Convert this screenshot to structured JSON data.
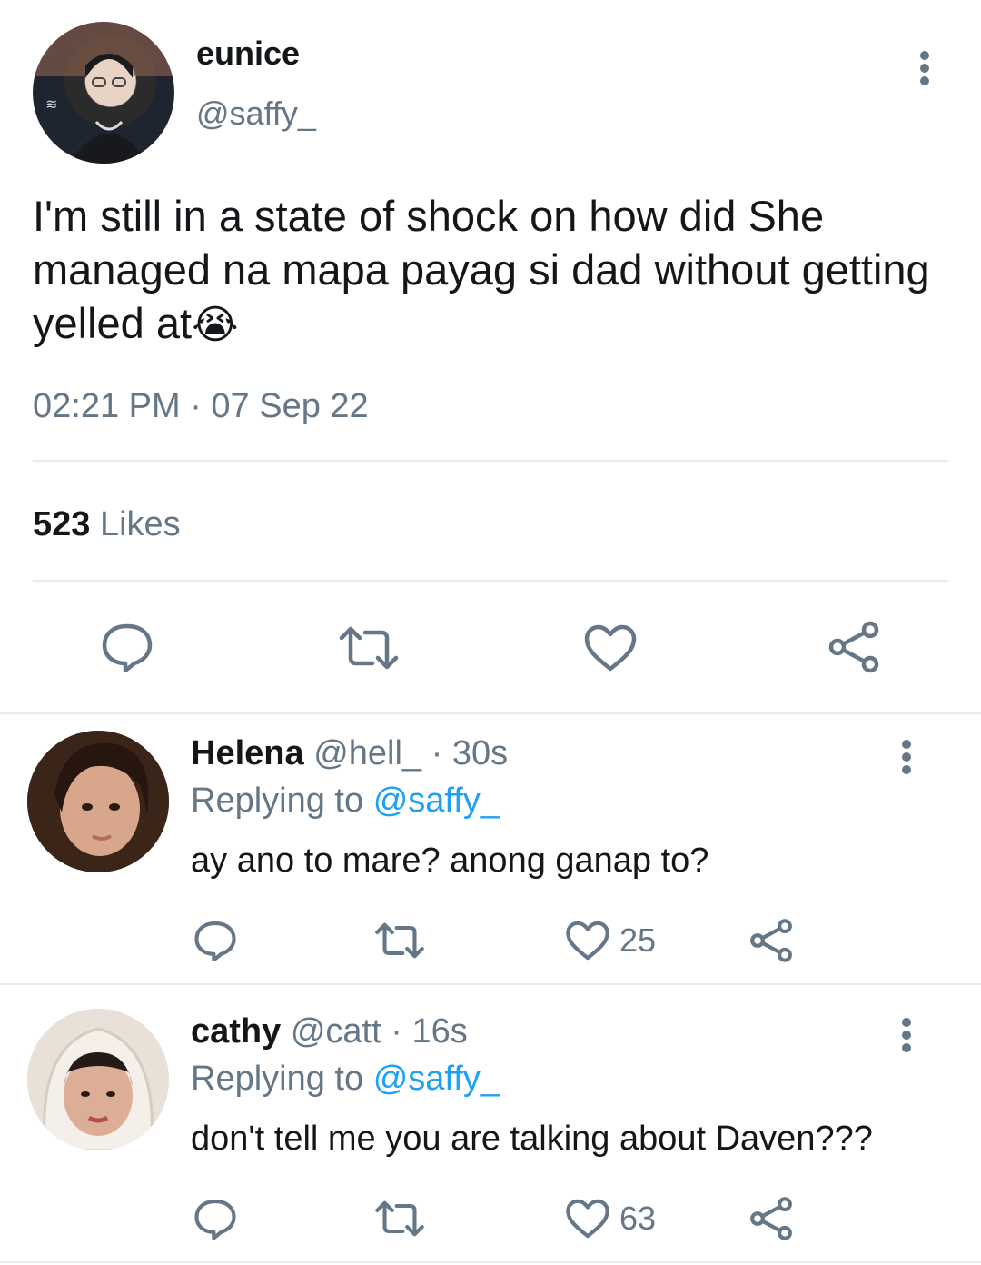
{
  "tweet": {
    "display_name": "eunice",
    "handle": "@saffy_",
    "text": "I'm still in a state of shock on how did She managed na mapa payag si dad without getting yelled at",
    "emoji": "😭",
    "timestamp": "02:21 PM · 07 Sep 22",
    "likes_count": "523",
    "likes_label": "Likes"
  },
  "replies": [
    {
      "display_name": "Helena",
      "handle": "@hell_",
      "time": "· 30s",
      "replying_prefix": "Replying to",
      "replying_to": "@saffy_",
      "text": "ay ano to mare? anong ganap to?",
      "likes": "25"
    },
    {
      "display_name": "cathy",
      "handle": "@catt",
      "time": "· 16s",
      "replying_prefix": "Replying to",
      "replying_to": "@saffy_",
      "text": "don't tell me you are talking about Daven???",
      "likes": "63"
    }
  ],
  "colors": {
    "text": "#14171a",
    "secondary": "#657786",
    "link": "#1da1f2",
    "divider": "#e6ecf0"
  },
  "icons": [
    "reply-icon",
    "retweet-icon",
    "like-icon",
    "share-icon",
    "more-icon"
  ]
}
